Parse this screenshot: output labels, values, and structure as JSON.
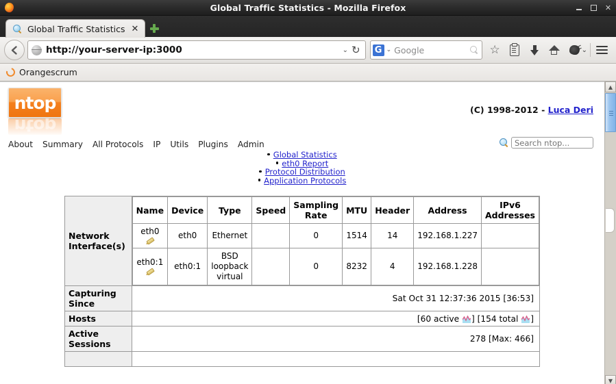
{
  "window": {
    "title": "Global Traffic Statistics - Mozilla Firefox",
    "minimize_label": "",
    "maximize_label": "",
    "close_label": "✕"
  },
  "tabs": [
    {
      "label": "Global Traffic Statistics",
      "close_label": "✕",
      "favicon": "magnifier-icon"
    }
  ],
  "newtab_label": "+",
  "toolbar": {
    "back_label": "←",
    "url": "http://your-server-ip:3000",
    "url_chevron": "⌄",
    "reload_label": "↻",
    "search_engine": "G",
    "search_engine_chevron": "⌄",
    "search_placeholder": "Google",
    "star_label": "☆",
    "icons": [
      "star-icon",
      "reader-icon",
      "download-icon",
      "home-icon",
      "pocket-icon",
      "menu-icon"
    ],
    "blob_chevron": "⌄"
  },
  "bookmarks": [
    {
      "label": "Orangescrum",
      "icon": "orangescrum-icon"
    }
  ],
  "page": {
    "logo_text": "ntop",
    "copyright_prefix": "(C) 1998-2012 - ",
    "copyright_author": "Luca Deri",
    "nav": [
      {
        "label": "About"
      },
      {
        "label": "Summary"
      },
      {
        "label": "All Protocols"
      },
      {
        "label": "IP"
      },
      {
        "label": "Utils"
      },
      {
        "label": "Plugins"
      },
      {
        "label": "Admin"
      }
    ],
    "search_placeholder": "Search ntop...",
    "links": [
      {
        "label": "Global Statistics",
        "level": 1
      },
      {
        "label": "eth0 Report",
        "level": 2
      },
      {
        "label": "Protocol Distribution",
        "level": 1
      },
      {
        "label": "Application Protocols",
        "level": 1
      }
    ],
    "table": {
      "row_headers": {
        "interfaces": "Network Interface(s)",
        "capturing_since": "Capturing Since",
        "hosts": "Hosts",
        "active_sessions": "Active Sessions"
      },
      "interface_columns": [
        "Name",
        "Device",
        "Type",
        "Speed",
        "Sampling Rate",
        "MTU",
        "Header",
        "Address",
        "IPv6 Addresses"
      ],
      "interfaces": [
        {
          "name": "eth0",
          "device": "eth0",
          "type": "Ethernet",
          "speed": "",
          "sampling_rate": "0",
          "mtu": "1514",
          "header": "14",
          "address": "192.168.1.227",
          "ipv6": ""
        },
        {
          "name": "eth0:1",
          "device": "eth0:1",
          "type": "BSD loopback virtual",
          "speed": "",
          "sampling_rate": "0",
          "mtu": "8232",
          "header": "4",
          "address": "192.168.1.228",
          "ipv6": ""
        }
      ],
      "capturing_since_value": "Sat Oct 31 12:37:36 2015 [36:53]",
      "hosts_active": "[60 active",
      "hosts_active_suffix": "]",
      "hosts_total": "[154 total",
      "hosts_total_suffix": "]",
      "active_sessions_value": "278 [Max: 466]"
    }
  },
  "colors": {
    "link": "#2222cc",
    "logo_orange": "#f4801e",
    "row_header_bg": "#eeeeee",
    "table_border": "#999999",
    "scroll_thumb": "#7fb3e8"
  }
}
